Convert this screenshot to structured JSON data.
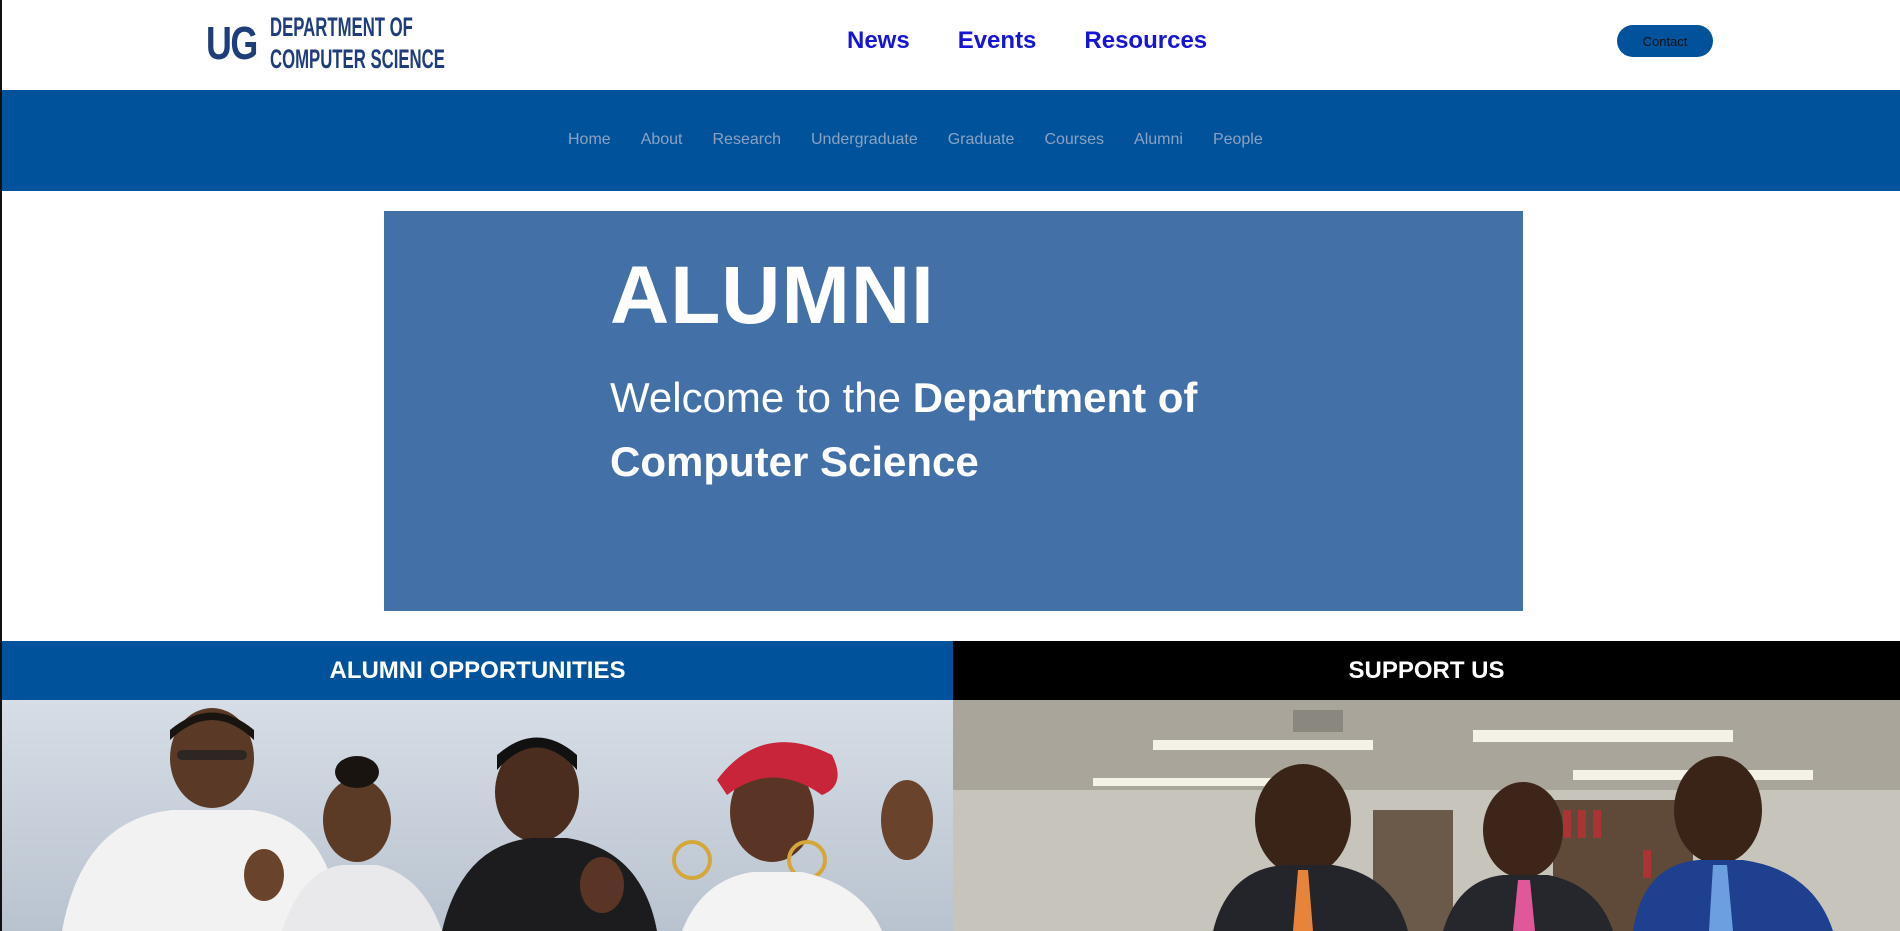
{
  "header": {
    "logo": {
      "short": "UG",
      "line1": "DEPARTMENT OF",
      "line2": "COMPUTER SCIENCE"
    },
    "top_nav": [
      {
        "label": "News"
      },
      {
        "label": "Events"
      },
      {
        "label": "Resources"
      }
    ],
    "contact_label": "Contact"
  },
  "main_nav": [
    {
      "label": "Home"
    },
    {
      "label": "About"
    },
    {
      "label": "Research"
    },
    {
      "label": "Undergraduate"
    },
    {
      "label": "Graduate"
    },
    {
      "label": "Courses"
    },
    {
      "label": "Alumni"
    },
    {
      "label": "People"
    }
  ],
  "hero": {
    "title": "ALUMNI",
    "subtitle_plain": "Welcome to the ",
    "subtitle_bold": "Department of Computer Science"
  },
  "panels": {
    "left_title": "ALUMNI OPPORTUNITIES",
    "right_title": "SUPPORT US"
  },
  "colors": {
    "brand_blue": "#00539b",
    "hero_blue": "#4370a7",
    "link_blue": "#1515d6"
  }
}
